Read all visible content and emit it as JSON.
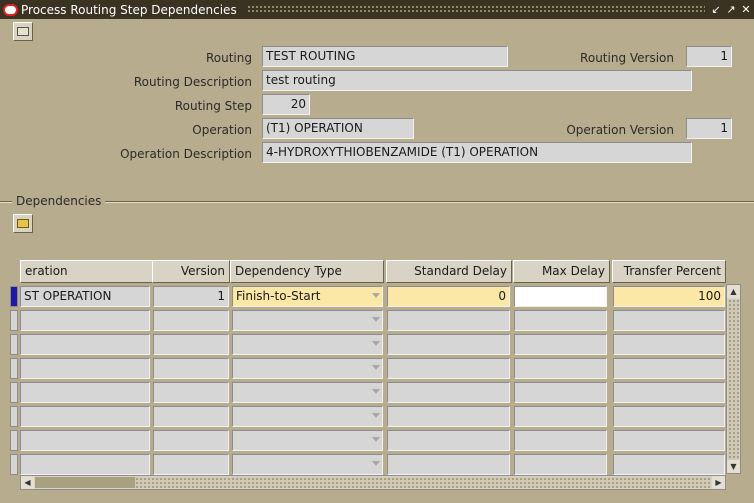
{
  "window": {
    "title": "Process Routing Step Dependencies",
    "buttons": [
      "minimize",
      "maximize",
      "close"
    ]
  },
  "header": {
    "routing_label": "Routing",
    "routing_value": "TEST ROUTING",
    "routing_version_label": "Routing Version",
    "routing_version_value": "1",
    "routing_description_label": "Routing Description",
    "routing_description_value": "test routing",
    "routing_step_label": "Routing Step",
    "routing_step_value": "20",
    "operation_label": "Operation",
    "operation_value": "(T1) OPERATION",
    "operation_version_label": "Operation Version",
    "operation_version_value": "1",
    "operation_description_label": "Operation Description",
    "operation_description_value": "4-HYDROXYTHIOBENZAMIDE (T1) OPERATION"
  },
  "section": {
    "dependencies_label": "Dependencies"
  },
  "grid": {
    "columns": [
      "eration",
      "Version",
      "Dependency Type",
      "Standard Delay",
      "Max Delay",
      "Transfer Percent"
    ],
    "rows": [
      {
        "operation": "ST OPERATION",
        "version": "1",
        "dependency_type": "Finish-to-Start",
        "standard_delay": "0",
        "max_delay": "",
        "transfer_percent": "100"
      }
    ],
    "empty_rows": 7
  },
  "colors": {
    "background": "#b7ad8e",
    "titlebar": "#3a3322",
    "required_field": "#fbe8a6",
    "current_row_indicator": "#1a1aa6"
  }
}
